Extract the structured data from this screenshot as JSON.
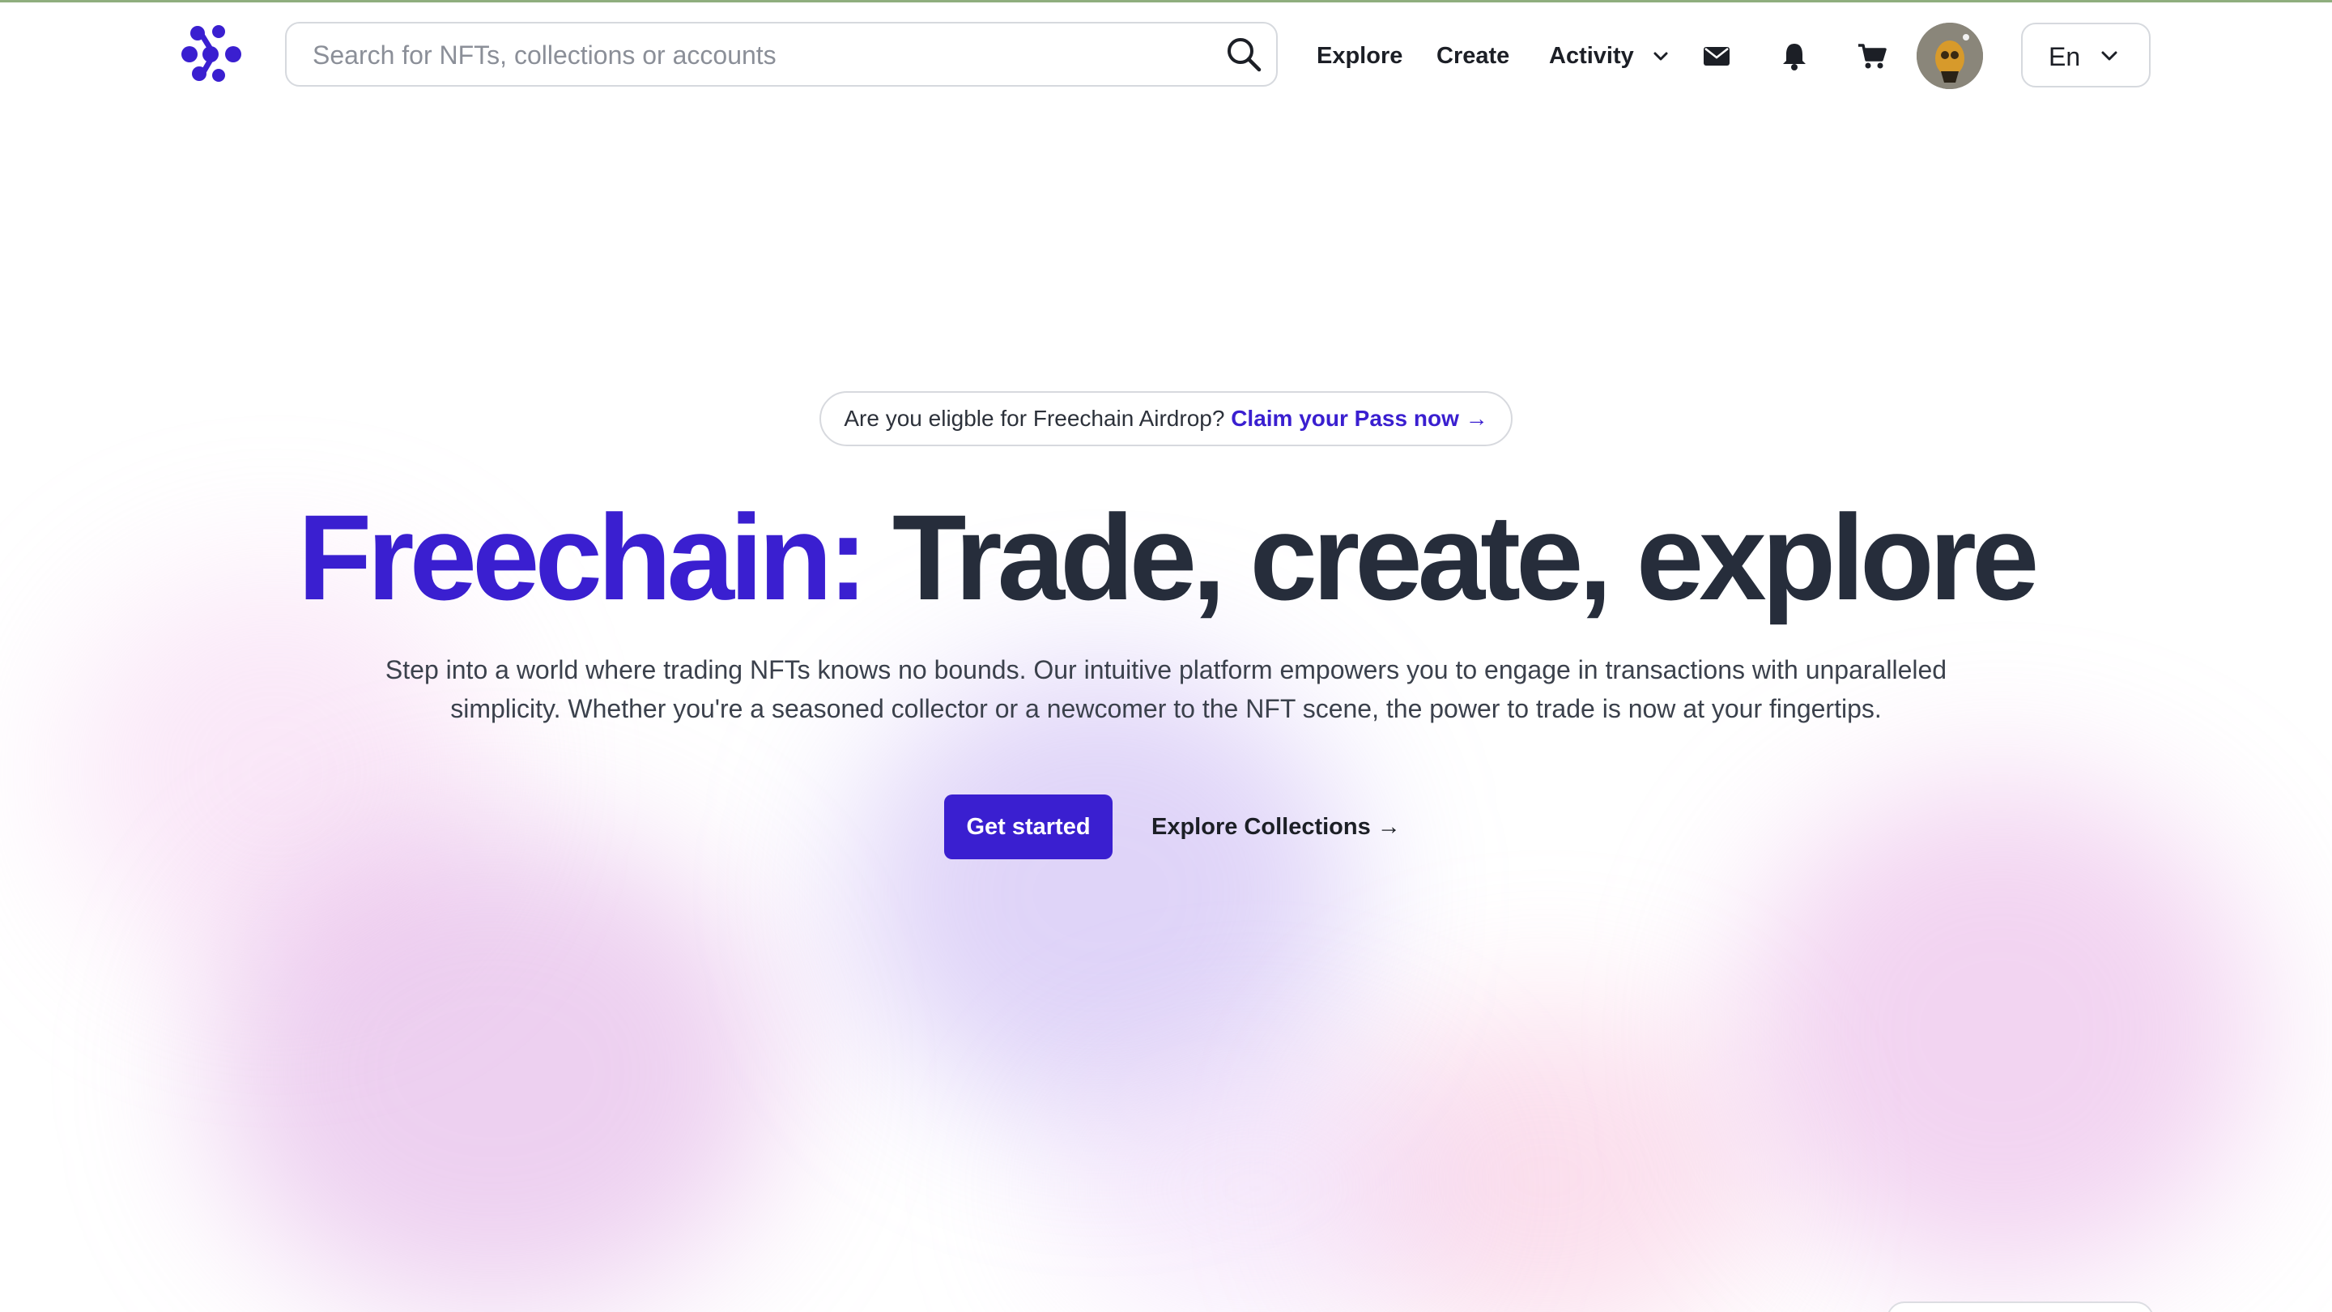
{
  "header": {
    "logo": "freechain-logo",
    "search": {
      "placeholder": "Search for NFTs, collections or accounts",
      "value": "",
      "icon": "search-icon"
    },
    "nav": {
      "explore": "Explore",
      "create": "Create",
      "activity": "Activity"
    },
    "icons": [
      "mail-icon",
      "bell-icon",
      "cart-icon"
    ],
    "language": "En"
  },
  "hero": {
    "announcement": {
      "text": "Are you eligble for Freechain Airdrop?",
      "link": "Claim your Pass now →"
    },
    "title_brand": "Freechain:",
    "title_rest": "Trade, create, explore",
    "subtitle": "Step into a world where trading NFTs knows no bounds. Our intuitive platform empowers you to engage in transactions with unparalleled simplicity. Whether you're a seasoned collector or a newcomer to the NFT scene, the power to trade is now at your fingertips.",
    "primary_cta": "Get started",
    "secondary_cta": "Explore Collections →"
  },
  "colors": {
    "accent": "#3a1fd0",
    "text_dark": "#262d3b",
    "border": "#d6d9de"
  }
}
